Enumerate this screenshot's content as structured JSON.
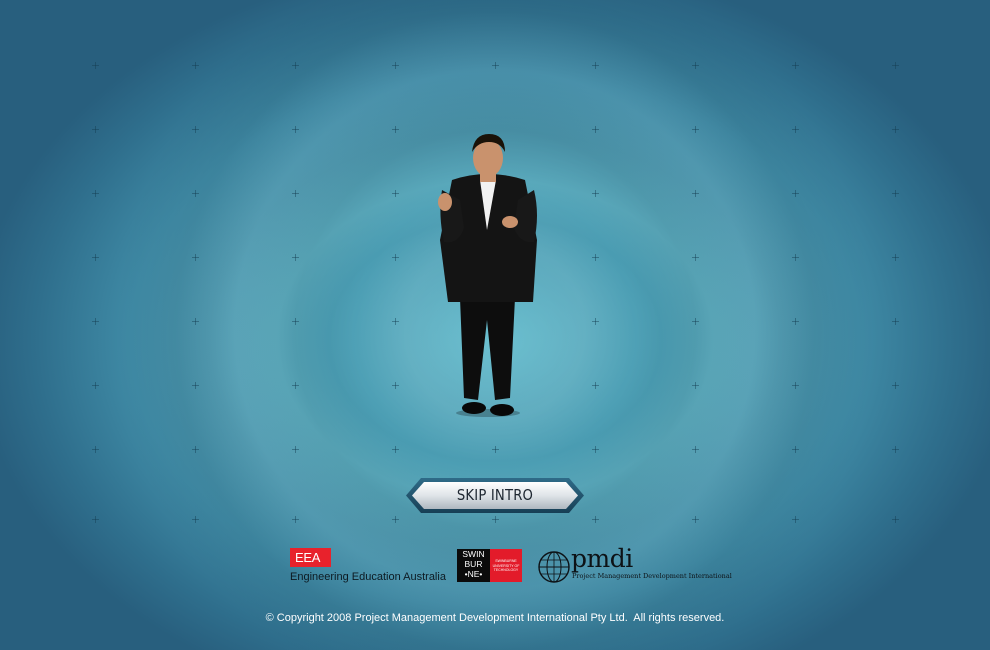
{
  "intro": {
    "skip_button": {
      "label": "SKIP INTRO"
    }
  },
  "logos": {
    "eea": {
      "mark": "EEA",
      "name": "Engineering Education Australia"
    },
    "swinburne": {
      "lines": [
        "SWIN",
        "BUR",
        "•NE•"
      ],
      "sub": [
        "SWINBURNE",
        "UNIVERSITY OF",
        "TECHNOLOGY"
      ]
    },
    "pmdi": {
      "mark": "pmdi",
      "name": "Project Management Development International"
    }
  },
  "footer": {
    "copyright": "© Copyright 2008 Project Management Development International Pty Ltd.  All rights reserved."
  },
  "colors": {
    "background_center": "#6bc0d0",
    "background_edge": "#285f7e",
    "eea_red": "#e8222c",
    "swinburne_red": "#e31b2a"
  }
}
